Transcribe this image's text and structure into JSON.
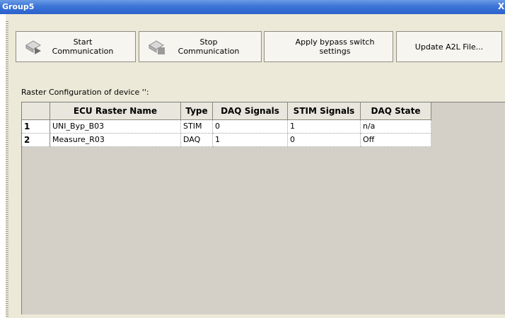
{
  "window": {
    "title": "Group5",
    "close_glyph": "X"
  },
  "toolbar": {
    "start_line1": "Start",
    "start_line2": "Communication",
    "stop_line1": "Stop",
    "stop_line2": "Communication",
    "bypass_line1": "Apply bypass switch",
    "bypass_line2": "settings",
    "update_label": "Update A2L File..."
  },
  "raster": {
    "caption": "Raster Configuration of device '':",
    "columns": [
      "ECU Raster Name",
      "Type",
      "DAQ Signals",
      "STIM Signals",
      "DAQ State"
    ],
    "rows": [
      {
        "index": "1",
        "name": "UNI_Byp_B03",
        "type": "STIM",
        "daq": "0",
        "stim": "1",
        "state": "n/a"
      },
      {
        "index": "2",
        "name": "Measure_R03",
        "type": "DAQ",
        "daq": "1",
        "stim": "0",
        "state": "Off"
      }
    ]
  },
  "colors": {
    "title_bar": "#2a62cc",
    "grid_background": "#d4d0c8",
    "panel": "#ece9d8"
  }
}
